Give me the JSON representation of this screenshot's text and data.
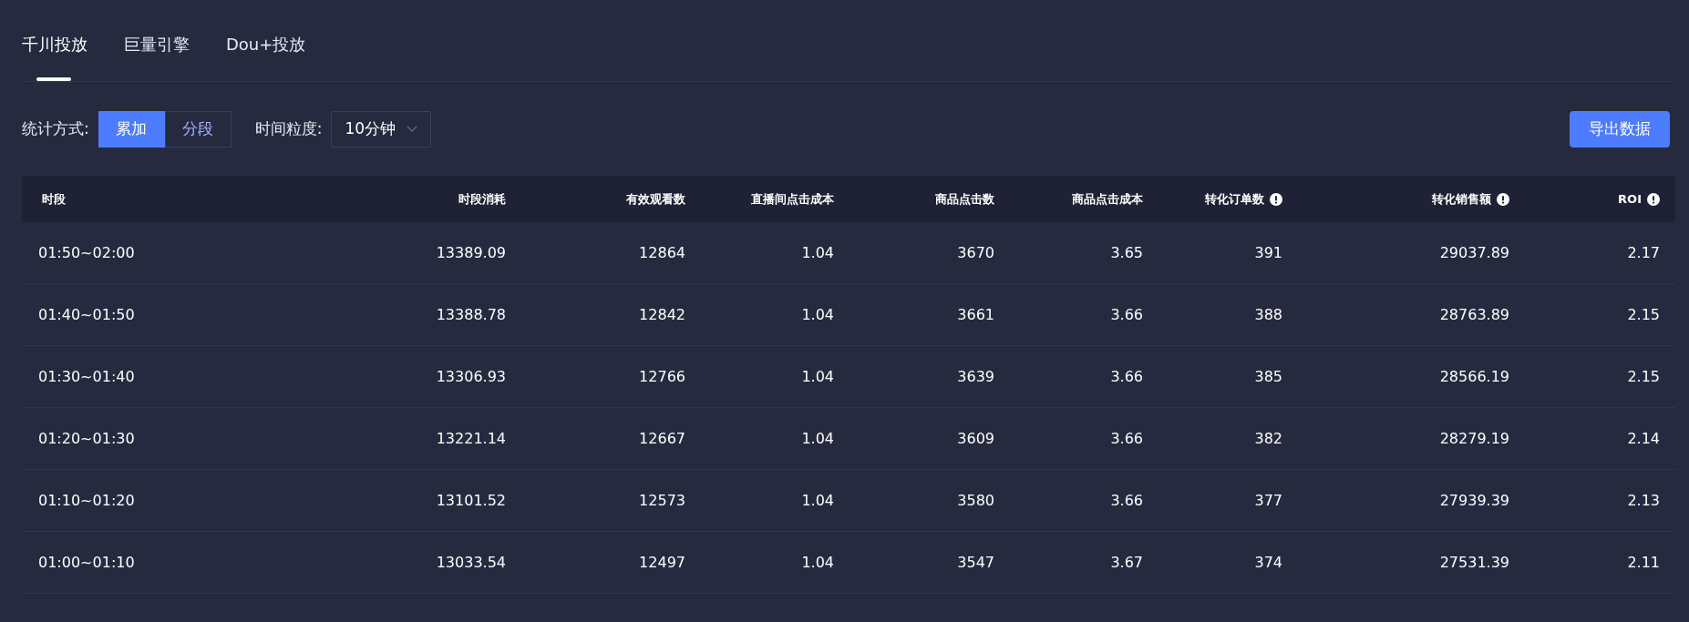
{
  "tabs": [
    {
      "label": "千川投放",
      "selected": true
    },
    {
      "label": "巨量引擎",
      "selected": false
    },
    {
      "label": "Dou+投放",
      "selected": false
    }
  ],
  "stat_mode": {
    "label": "统计方式:",
    "options": [
      {
        "label": "累加",
        "selected": true
      },
      {
        "label": "分段",
        "selected": false
      }
    ]
  },
  "granularity": {
    "label": "时间粒度:",
    "value": "10分钟"
  },
  "export_button": "导出数据",
  "table": {
    "columns": [
      {
        "label": "时段",
        "info": false
      },
      {
        "label": "时段消耗",
        "info": false
      },
      {
        "label": "有效观看数",
        "info": false
      },
      {
        "label": "直播间点击成本",
        "info": false
      },
      {
        "label": "商品点击数",
        "info": false
      },
      {
        "label": "商品点击成本",
        "info": false
      },
      {
        "label": "转化订单数",
        "info": true
      },
      {
        "label": "转化销售额",
        "info": true
      },
      {
        "label": "ROI",
        "info": true
      }
    ],
    "rows": [
      [
        "01:50~02:00",
        "13389.09",
        "12864",
        "1.04",
        "3670",
        "3.65",
        "391",
        "29037.89",
        "2.17"
      ],
      [
        "01:40~01:50",
        "13388.78",
        "12842",
        "1.04",
        "3661",
        "3.66",
        "388",
        "28763.89",
        "2.15"
      ],
      [
        "01:30~01:40",
        "13306.93",
        "12766",
        "1.04",
        "3639",
        "3.66",
        "385",
        "28566.19",
        "2.15"
      ],
      [
        "01:20~01:30",
        "13221.14",
        "12667",
        "1.04",
        "3609",
        "3.66",
        "382",
        "28279.19",
        "2.14"
      ],
      [
        "01:10~01:20",
        "13101.52",
        "12573",
        "1.04",
        "3580",
        "3.66",
        "377",
        "27939.39",
        "2.13"
      ],
      [
        "01:00~01:10",
        "13033.54",
        "12497",
        "1.04",
        "3547",
        "3.67",
        "374",
        "27531.39",
        "2.11"
      ]
    ]
  }
}
